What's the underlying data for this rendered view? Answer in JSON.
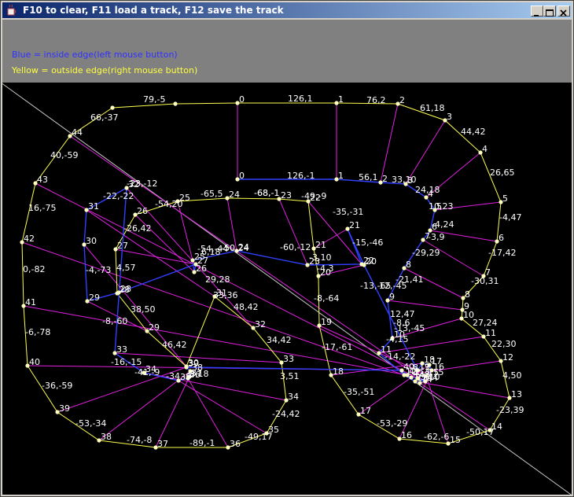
{
  "window": {
    "title": "F10 to clear, F11 load a track, F12 save the track",
    "icon": "java-cup-icon",
    "controls": [
      "minimize-icon",
      "maximize-icon",
      "close-icon"
    ]
  },
  "legend": {
    "inside": "Blue = inside edge(left mouse button)",
    "outside": "Yellow = outside edge(right mouse button)"
  },
  "colors": {
    "inside_edge": "#3040ff",
    "outside_edge": "#ffff50",
    "spoke": "#e020e0",
    "diagonal": "#c8c8c8",
    "background": "#000000",
    "info_panel": "#808080",
    "node": "#ffffc0",
    "label": "#ffffff"
  },
  "track": {
    "outer_point_ids": [
      "0",
      "1",
      "2",
      "3",
      "4",
      "5",
      "6",
      "7",
      "8",
      "9",
      "10",
      "11",
      "12",
      "13",
      "14",
      "15",
      "16",
      "17",
      "18",
      "19",
      "20",
      "21",
      "22",
      "23",
      "24",
      "25",
      "26",
      "27",
      "28",
      "29",
      "30",
      "31",
      "32",
      "33",
      "34",
      "35",
      "36",
      "37",
      "38",
      "39",
      "40",
      "41",
      "42",
      "43",
      "44"
    ],
    "outer_labels": [
      "126,1",
      "76,2",
      "61,18",
      "44,42",
      "26,65",
      "-4,47",
      "-17,42",
      "-30,31",
      "-21,41",
      "12,47",
      "27,24",
      "22,30",
      "4,50",
      "-23,39",
      "-50,17",
      "-62,-6",
      "-53,-29",
      "-35,-51",
      "-17,-61",
      "-8,-64",
      "-13,-65",
      "-15,-46",
      "-35,-31",
      "-49,-9",
      "-68,-1",
      "-65,5",
      "-54,20",
      "-26,42",
      "4,57",
      "38,50",
      "46,42",
      "48,42",
      "34,42",
      "3,51",
      "-24,42",
      "-49,17",
      "-89,-1",
      "-74,-8",
      "-53,-34",
      "-36,-59",
      "-6,-78",
      "0,-82",
      "16,-75",
      "40,-59",
      "66,-37",
      "79,-5"
    ],
    "inner_point_ids": [
      "0",
      "1",
      "2",
      "3",
      "4",
      "5",
      "6",
      "7",
      "8",
      "9",
      "10",
      "11",
      "12",
      "13",
      "14",
      "15",
      "16",
      "17",
      "18",
      "19",
      "20",
      "21",
      "22",
      "23",
      "24",
      "25",
      "26",
      "27",
      "28",
      "29",
      "30",
      "31",
      "32",
      "33",
      "34",
      "35",
      "36",
      "37",
      "38",
      "39",
      "40",
      "41",
      "42",
      "43",
      "44"
    ],
    "inner_labels": [
      "126,-1",
      "56,1",
      "33,10",
      "24,18",
      "10,23",
      "-4,24",
      "-3,9",
      "-29,29",
      "-13,-45",
      "-14,-22",
      "-8,6",
      "-4,15",
      "-8,-7",
      "-3,10",
      "-50,24",
      "-60,-12",
      "-68,-1",
      "-54,-44",
      "-22,-22",
      "-23,-12",
      "12,-45",
      "-4,-73",
      "-8,-60",
      "-16,-15",
      "-41,-9",
      "-34,-6",
      "29,28",
      "33,36",
      "6,18",
      "8,18",
      "4,15",
      "-3,10",
      "-4,3"
    ]
  }
}
